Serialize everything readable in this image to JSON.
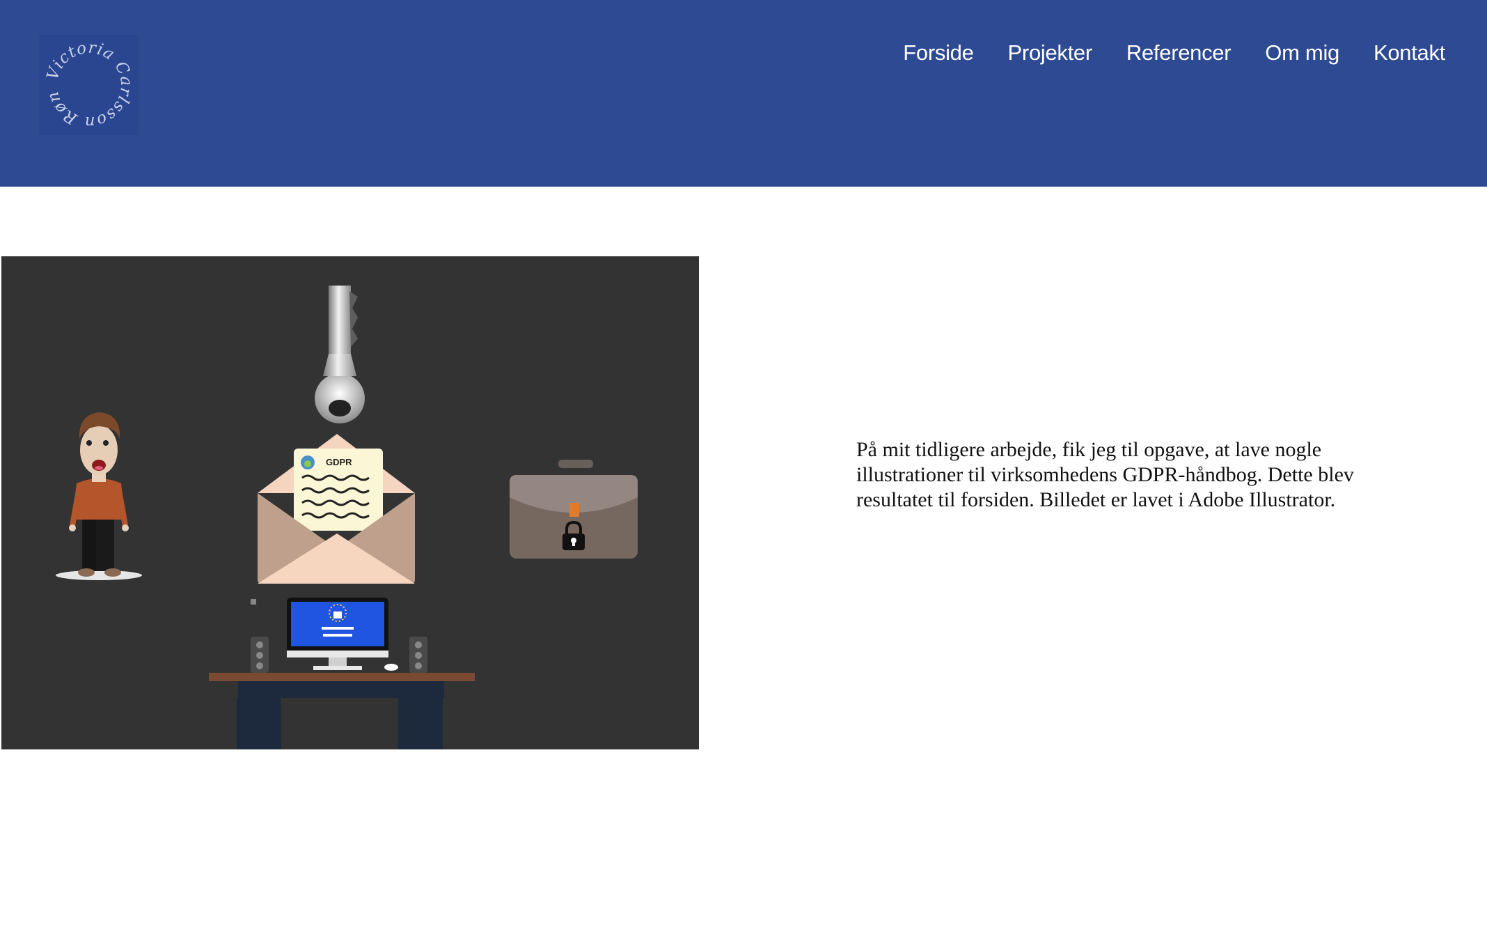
{
  "header": {
    "background_color": "#2e4a93",
    "logo": {
      "text": "Victoria Carlsson Rønne",
      "icon": "circular-signature-logo"
    },
    "nav": [
      {
        "label": "Forside"
      },
      {
        "label": "Projekter"
      },
      {
        "label": "Referencer"
      },
      {
        "label": "Om mig"
      },
      {
        "label": "Kontakt"
      }
    ]
  },
  "main": {
    "illustration": {
      "background_color": "#333333",
      "letter_label": "GDPR"
    },
    "description": "På mit tidligere arbejde, fik jeg til opgave, at lave nogle illustrationer til virksomhedens GDPR-håndbog. Dette blev resultatet til forsiden. Billedet er lavet i Adobe Illustrator."
  }
}
